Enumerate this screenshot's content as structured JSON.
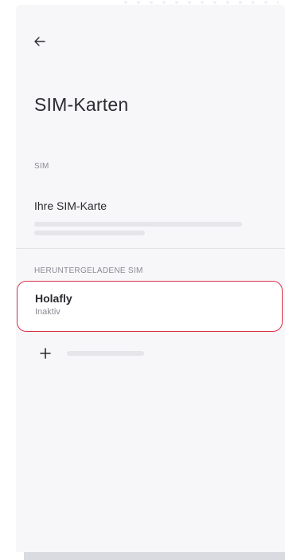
{
  "header": {
    "back_icon": "arrow-left-icon",
    "title": "SIM-Karten"
  },
  "sim_section": {
    "label": "SIM",
    "item": {
      "name": "Ihre SIM-Karte"
    }
  },
  "esim_section": {
    "label": "HERUNTERGELADENE SIM",
    "item": {
      "name": "Holafly",
      "status": "Inaktiv",
      "highlight_color": "#d8314a"
    }
  },
  "add_action": {
    "icon": "plus-icon"
  }
}
